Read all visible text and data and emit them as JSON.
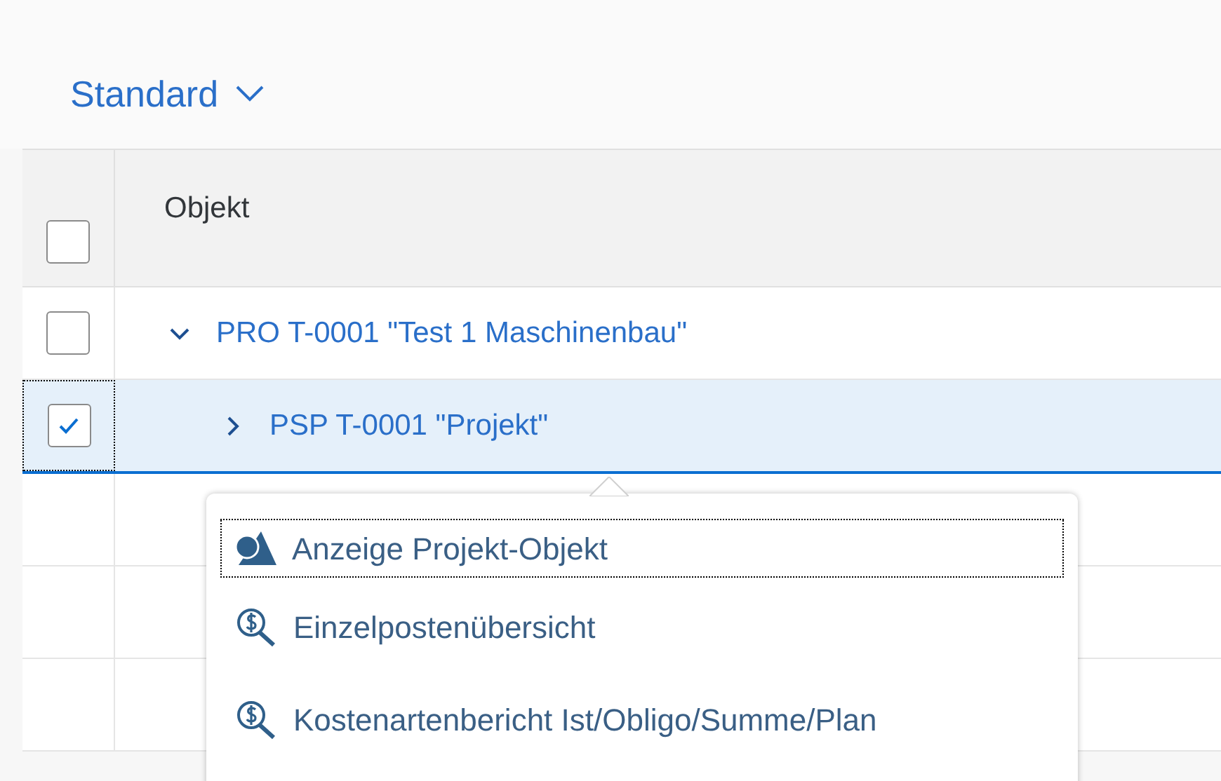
{
  "variant": {
    "label": "Standard"
  },
  "table": {
    "columns": [
      "Objekt"
    ],
    "header_checkbox": {
      "checked": false
    },
    "rows": [
      {
        "text": "PRO T-0001 \"Test 1 Maschinenbau\"",
        "expanded": true,
        "checked": false,
        "selected": false,
        "children": [
          {
            "text": "PSP T-0001 \"Projekt\"",
            "expanded": false,
            "checked": true,
            "selected": true
          }
        ]
      }
    ]
  },
  "context_menu": {
    "items": [
      {
        "label": "Anzeige Projekt-Objekt",
        "kind": "shapes",
        "focused": true
      },
      {
        "label": "Einzelpostenübersicht",
        "kind": "money-search",
        "focused": false
      },
      {
        "label": "Kostenartenbericht Ist/Obligo/Summe/Plan",
        "kind": "money-search",
        "focused": false
      }
    ]
  }
}
